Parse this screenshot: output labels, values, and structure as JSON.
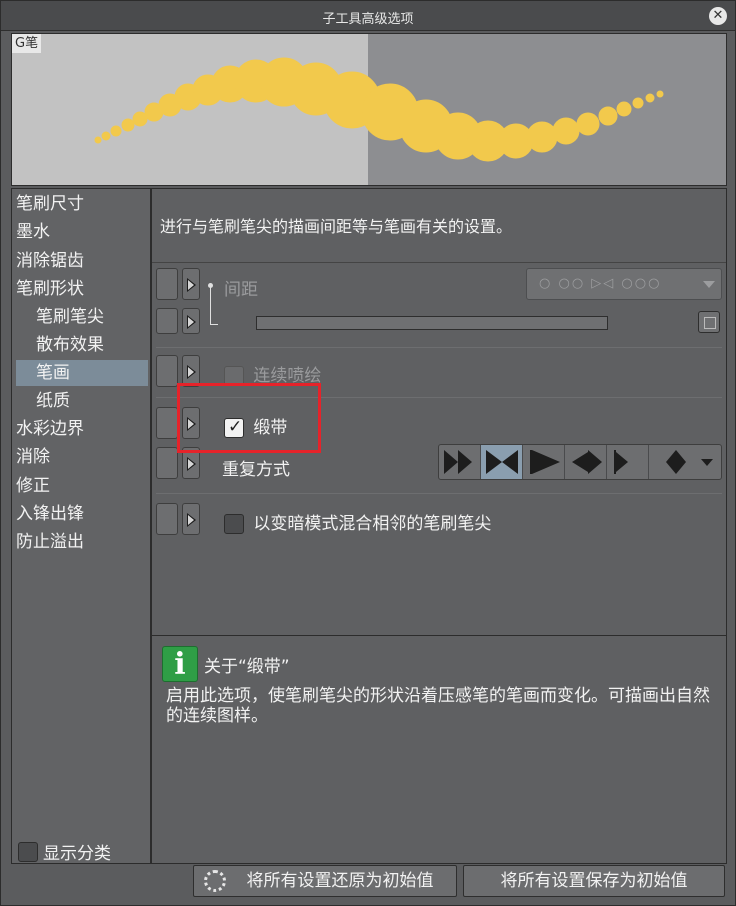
{
  "window": {
    "title": "子工具高级选项",
    "close_symbol": "✕"
  },
  "preview": {
    "label": "G笔"
  },
  "sidebar": {
    "items": [
      {
        "label": "笔刷尺寸"
      },
      {
        "label": "墨水"
      },
      {
        "label": "消除锯齿"
      },
      {
        "label": "笔刷形状"
      },
      {
        "label": "笔刷笔尖"
      },
      {
        "label": "散布效果"
      },
      {
        "label": "笔画"
      },
      {
        "label": "纸质"
      },
      {
        "label": "水彩边界"
      },
      {
        "label": "消除"
      },
      {
        "label": "修正"
      },
      {
        "label": "入锋出锋"
      },
      {
        "label": "防止溢出"
      }
    ],
    "selected": "笔画",
    "show_category": {
      "label": "显示分类",
      "checked": false
    }
  },
  "main": {
    "description": "进行与笔刷笔尖的描画间距等与笔画有关的设置。",
    "spacing": {
      "label": "间距",
      "select_display": "○ ○○ ▷◁ ○○○"
    },
    "continuous_spray": {
      "label": "连续喷绘",
      "checked": false
    },
    "ribbon": {
      "label": "缎带",
      "checked": true
    },
    "repeat_mode": {
      "label": "重复方式",
      "options": [
        "repeat",
        "repeat-reverse",
        "once",
        "once-reverse",
        "rebound",
        "rebound-reverse"
      ],
      "selected_index": 1
    },
    "darken_blend": {
      "label": "以变暗模式混合相邻的笔刷笔尖",
      "checked": false
    }
  },
  "info": {
    "title": "关于“缎带”",
    "text": "启用此选项，使笔刷笔尖的形状沿着压感笔的笔画而变化。可描画出自然的连续图样。"
  },
  "buttons": {
    "reset_all": "将所有设置还原为初始值",
    "save_all": "将所有设置保存为初始值"
  },
  "colors": {
    "accent_selected": "#7c8c99",
    "stroke_preview": "#f2c94c",
    "highlight_box": "#e6232a",
    "info_icon": "#2f9e46"
  }
}
